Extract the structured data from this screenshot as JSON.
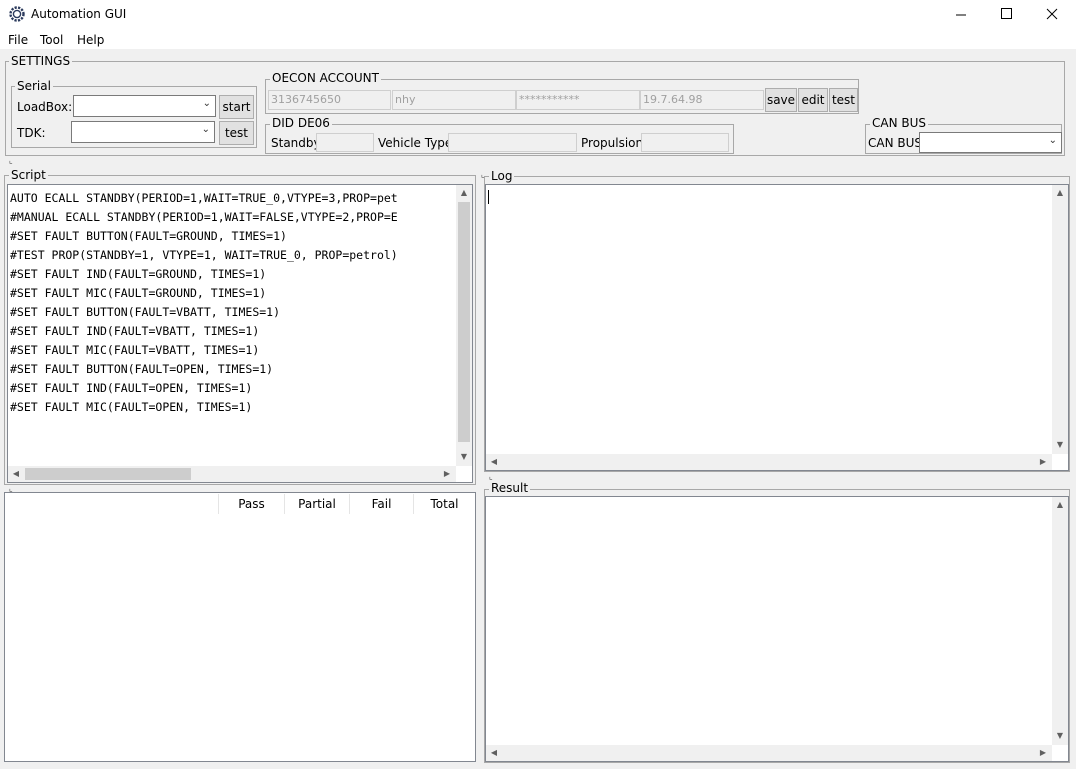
{
  "window": {
    "title": "Automation GUI"
  },
  "menu": [
    "File",
    "Tool",
    "Help"
  ],
  "settings": {
    "title": "SETTINGS",
    "serial": {
      "title": "Serial",
      "loadbox_label": "LoadBox:",
      "tdk_label": "TDK:",
      "start_label": "start",
      "test_label": "test"
    },
    "oecon": {
      "title": "OECON ACCOUNT",
      "field1": "3136745650",
      "field2": "nhy",
      "field3": "***********",
      "field4": "19.7.64.98",
      "save_label": "save",
      "edit_label": "edit",
      "test_label": "test"
    },
    "did": {
      "title": "DID DE06",
      "standby_label": "Standby",
      "vehicle_label": "Vehicle Type",
      "propulsion_label": "Propulsion"
    },
    "canbus": {
      "title": "CAN BUS",
      "label": "CAN BUS"
    }
  },
  "script": {
    "title": "Script",
    "lines": [
      "AUTO ECALL STANDBY(PERIOD=1,WAIT=TRUE_0,VTYPE=3,PROP=pet",
      "#MANUAL ECALL STANDBY(PERIOD=1,WAIT=FALSE,VTYPE=2,PROP=E",
      "#SET FAULT BUTTON(FAULT=GROUND, TIMES=1)",
      "#TEST PROP(STANDBY=1, VTYPE=1, WAIT=TRUE_0, PROP=petrol)",
      "#SET FAULT IND(FAULT=GROUND, TIMES=1)",
      "#SET FAULT MIC(FAULT=GROUND, TIMES=1)",
      "#SET FAULT BUTTON(FAULT=VBATT, TIMES=1)",
      "#SET FAULT IND(FAULT=VBATT, TIMES=1)",
      "#SET FAULT MIC(FAULT=VBATT, TIMES=1)",
      "#SET FAULT BUTTON(FAULT=OPEN, TIMES=1)",
      "#SET FAULT IND(FAULT=OPEN, TIMES=1)",
      "#SET FAULT MIC(FAULT=OPEN, TIMES=1)"
    ]
  },
  "log": {
    "title": "Log"
  },
  "result": {
    "title": "Result"
  },
  "summary": {
    "columns": [
      "Pass",
      "Partial",
      "Fail",
      "Total"
    ]
  }
}
